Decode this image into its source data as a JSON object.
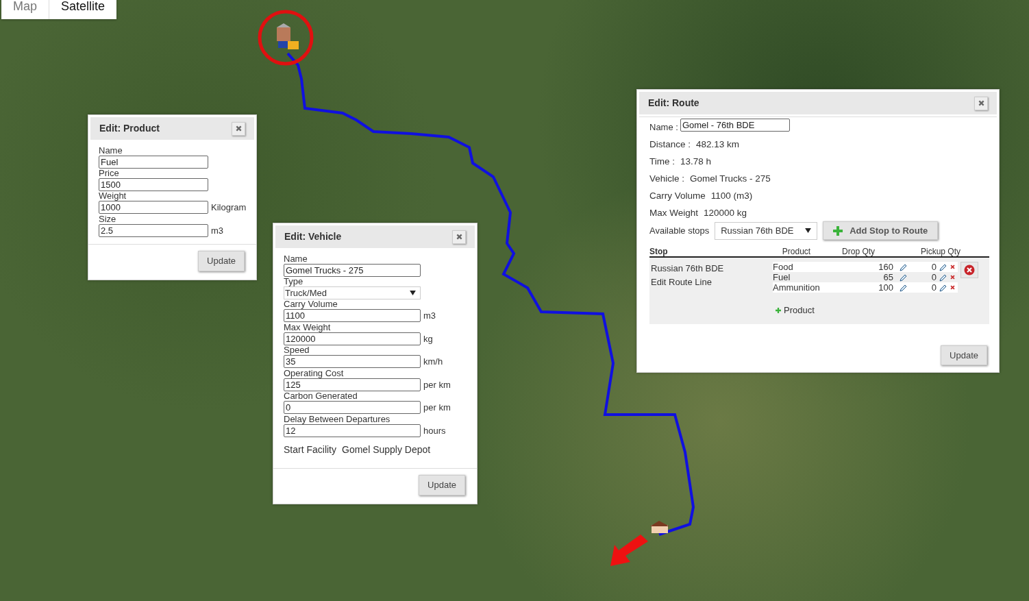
{
  "map_type_tabs": [
    {
      "label": "Map",
      "selected": false
    },
    {
      "label": "Satellite",
      "selected": true
    }
  ],
  "product_dialog": {
    "title": "Edit: Product",
    "fields": [
      {
        "label": "Name",
        "value": "Fuel"
      },
      {
        "label": "Price",
        "value": "1500"
      },
      {
        "label": "Weight",
        "value": "1000",
        "unit": "Kilogram"
      },
      {
        "label": "Size",
        "value": "2.5",
        "unit": "m3"
      }
    ],
    "button": "Update"
  },
  "vehicle_dialog": {
    "title": "Edit: Vehicle",
    "fields": [
      {
        "kind": "text",
        "label": "Name",
        "value": "Gomel Trucks - 275"
      },
      {
        "kind": "select",
        "label": "Type",
        "value": "Truck/Med"
      },
      {
        "kind": "text",
        "label": "Carry Volume",
        "value": "1100",
        "unit": "m3"
      },
      {
        "kind": "text",
        "label": "Max Weight",
        "value": "120000",
        "unit": "kg"
      },
      {
        "kind": "text",
        "label": "Speed",
        "value": "35",
        "unit": "km/h"
      },
      {
        "kind": "text",
        "label": "Operating Cost",
        "value": "125",
        "unit": "per km"
      },
      {
        "kind": "text",
        "label": "Carbon Generated",
        "value": "0",
        "unit": "per km"
      },
      {
        "kind": "text",
        "label": "Delay Between Departures",
        "value": "12",
        "unit": "hours"
      }
    ],
    "start_facility": {
      "label": "Start Facility",
      "value": "Gomel Supply Depot"
    },
    "button": "Update"
  },
  "route_dialog": {
    "title": "Edit: Route",
    "name": {
      "label": "Name :",
      "value": "Gomel - 76th BDE"
    },
    "info": [
      {
        "label": "Distance :",
        "value": "482.13 km"
      },
      {
        "label": "Time :",
        "value": "13.78 h"
      },
      {
        "label": "Vehicle :",
        "value": "Gomel Trucks - 275"
      },
      {
        "label": "Carry Volume",
        "value": "1100 (m3)"
      },
      {
        "label": "Max Weight",
        "value": "120000 kg"
      }
    ],
    "available_stops": {
      "label": "Available stops",
      "value": "Russian 76th BDE"
    },
    "add_stop_button": "Add Stop to Route",
    "columns": [
      "Stop",
      "Product",
      "Drop Qty",
      "Pickup Qty"
    ],
    "stops": [
      {
        "name": "Russian 76th BDE",
        "link": "Edit Route Line",
        "products": [
          {
            "product": "Food",
            "drop_qty": "160",
            "pickup_qty": "0"
          },
          {
            "product": "Fuel",
            "drop_qty": "65",
            "pickup_qty": "0"
          },
          {
            "product": "Ammunition",
            "drop_qty": "100",
            "pickup_qty": "0"
          }
        ],
        "add_product": "Product"
      }
    ],
    "button": "Update"
  }
}
